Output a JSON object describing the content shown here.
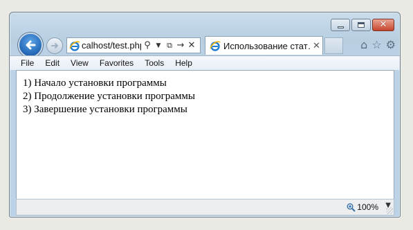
{
  "window": {
    "caption_buttons": {
      "minimize": "minimize-icon",
      "maximize": "maximize-icon",
      "close": "close-icon"
    }
  },
  "nav": {
    "address": "calhost/test.php",
    "address_icons": [
      "search-icon",
      "dropdown-icon",
      "compat-view-icon",
      "go-icon",
      "stop-icon"
    ],
    "tab_title": "Использование стат…",
    "tab_close": "✕",
    "right_icons": [
      "home-icon",
      "favorites-star-icon",
      "settings-gear-icon"
    ]
  },
  "menu": {
    "items": [
      "File",
      "Edit",
      "View",
      "Favorites",
      "Tools",
      "Help"
    ]
  },
  "content": {
    "lines": [
      "1) Начало установки программы",
      "2) Продолжение установки программы",
      "3) Завершение установки программы"
    ]
  },
  "status": {
    "zoom": "100%"
  },
  "colors": {
    "frame": "#bcd2e6",
    "back_button": "#2a6fbe",
    "close_button": "#c7462d"
  }
}
